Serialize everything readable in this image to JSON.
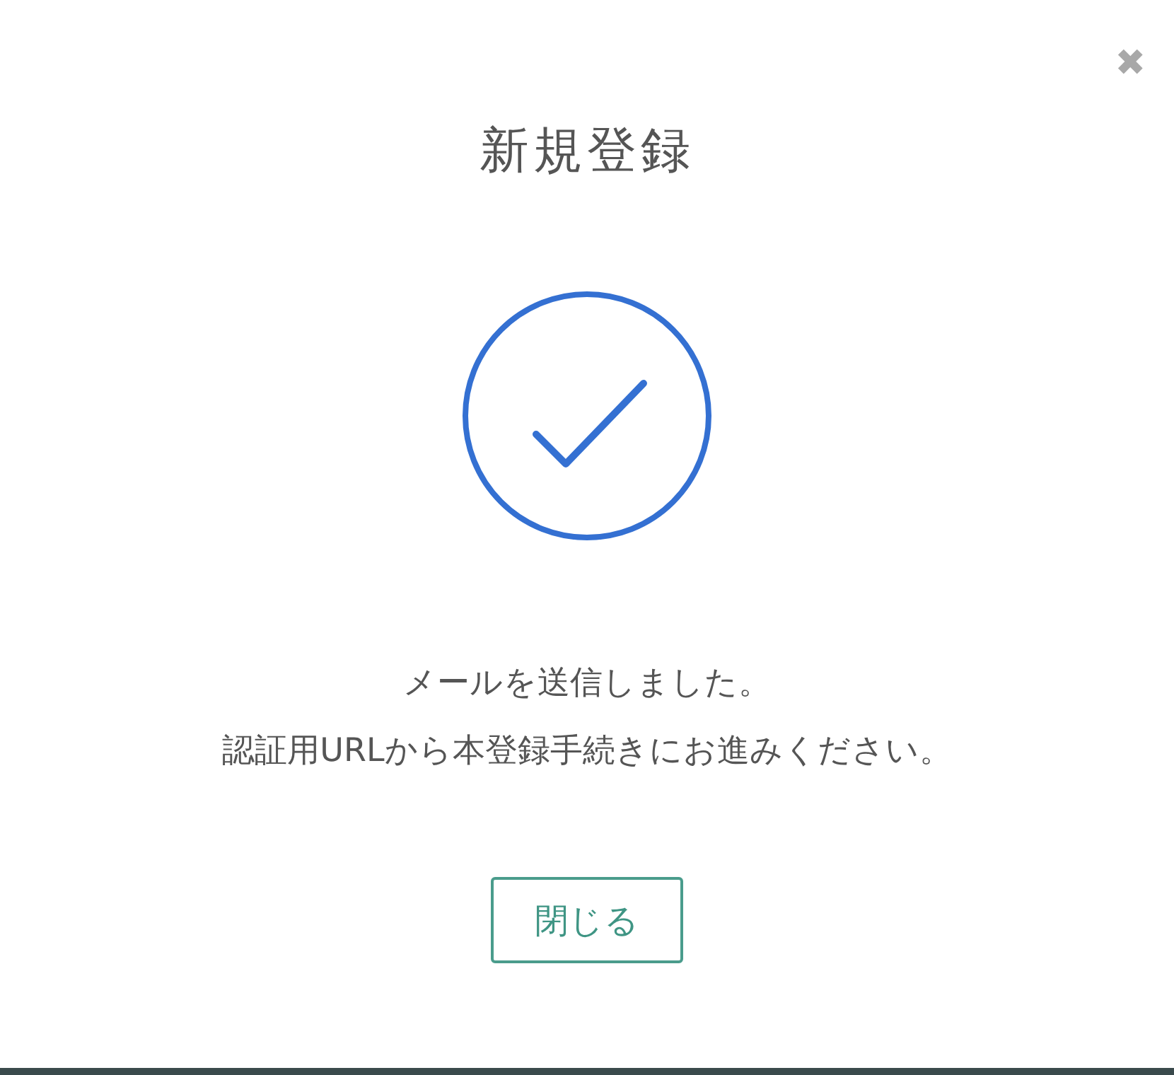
{
  "dialog": {
    "title": "新規登録",
    "close": "✖",
    "messages": [
      "メールを送信しました。",
      "認証用URLから本登録手続きにお進みください。"
    ],
    "button": "閉じる"
  }
}
